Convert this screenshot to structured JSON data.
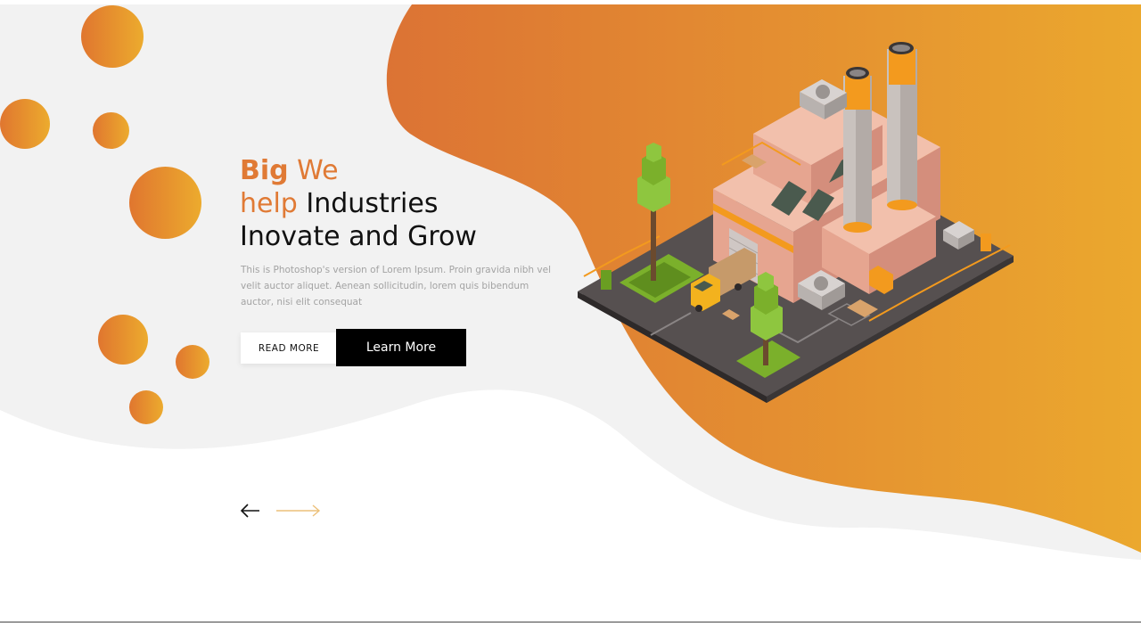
{
  "hero": {
    "headline_part1": "Big",
    "headline_part2": "We",
    "headline_part3": "help",
    "headline_part4": "Industries",
    "headline_part5": "Inovate and Grow",
    "description": "This is Photoshop's version  of Lorem Ipsum. Proin gravida nibh vel velit auctor aliquet. Aenean sollicitudin, lorem quis bibendum auctor, nisi elit consequat"
  },
  "buttons": {
    "read_more": "READ MORE",
    "learn_more": "Learn More"
  },
  "slider": {
    "prev_icon": "arrow-left-icon",
    "next_icon": "arrow-right-icon"
  },
  "illustration": "isometric-factory-illustration",
  "colors": {
    "accent_start": "#e0762f",
    "accent_end": "#ecab2e",
    "light_bg": "#f2f2f2",
    "dark": "#000000",
    "text": "#111111",
    "muted": "#a3a3a3"
  }
}
